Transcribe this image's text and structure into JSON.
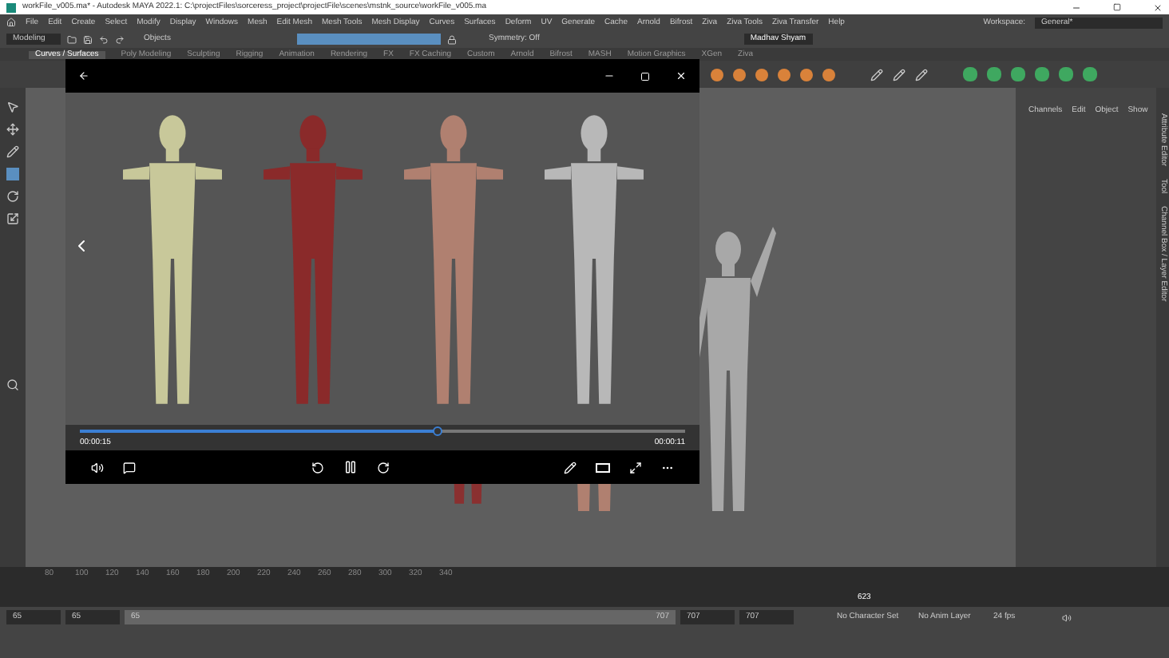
{
  "window": {
    "title": "workFile_v005.ma* - Autodesk MAYA 2022.1: C:\\projectFiles\\sorceress_project\\projectFile\\scenes\\mstnk_source\\workFile_v005.ma"
  },
  "menu": [
    "File",
    "Edit",
    "Create",
    "Select",
    "Modify",
    "Display",
    "Windows",
    "Mesh",
    "Edit Mesh",
    "Mesh Tools",
    "Mesh Display",
    "Curves",
    "Surfaces",
    "Deform",
    "UV",
    "Generate",
    "Cache",
    "Arnold",
    "Bifrost",
    "Ziva",
    "Ziva Tools",
    "Ziva Transfer",
    "Help"
  ],
  "workspace": {
    "label": "Workspace:",
    "value": "General*"
  },
  "status_line": {
    "menu_set": "Modeling",
    "selection_mode": "Objects",
    "symmetry": "Symmetry: Off",
    "user": "Madhav Shyam"
  },
  "shelf_tabs": [
    {
      "label": "Curves / Surfaces",
      "selected": true
    },
    {
      "label": "Poly Modeling",
      "selected": false
    },
    {
      "label": "Sculpting",
      "selected": false
    },
    {
      "label": "Rigging",
      "selected": false
    },
    {
      "label": "Animation",
      "selected": false
    },
    {
      "label": "Rendering",
      "selected": false
    },
    {
      "label": "FX",
      "selected": false
    },
    {
      "label": "FX Caching",
      "selected": false
    },
    {
      "label": "Custom",
      "selected": false
    },
    {
      "label": "Arnold",
      "selected": false
    },
    {
      "label": "Bifrost",
      "selected": false
    },
    {
      "label": "MASH",
      "selected": false
    },
    {
      "label": "Motion Graphics",
      "selected": false
    },
    {
      "label": "XGen",
      "selected": false
    },
    {
      "label": "Ziva",
      "selected": false
    }
  ],
  "channel_box": {
    "menu": [
      "Channels",
      "Edit",
      "Object",
      "Show"
    ],
    "side_tabs": [
      "Attribute Editor",
      "Tool",
      "Channel Box / Layer Editor"
    ]
  },
  "video_player": {
    "elapsed": "00:00:15",
    "remaining": "00:00:11",
    "level": 0.59
  },
  "timeline": {
    "ticks": [
      "80",
      "100",
      "120",
      "140",
      "160",
      "180",
      "200",
      "220",
      "240",
      "260",
      "280",
      "300",
      "320",
      "340"
    ],
    "current_frame": "623"
  },
  "range": {
    "start": "65",
    "playback_start": "65",
    "slider_start": "65",
    "slider_end": "707",
    "level": 1,
    "playback_end": "707",
    "end": "707",
    "character_set": "No Character Set",
    "anim_layer": "No Anim Layer",
    "fps": "24 fps"
  }
}
